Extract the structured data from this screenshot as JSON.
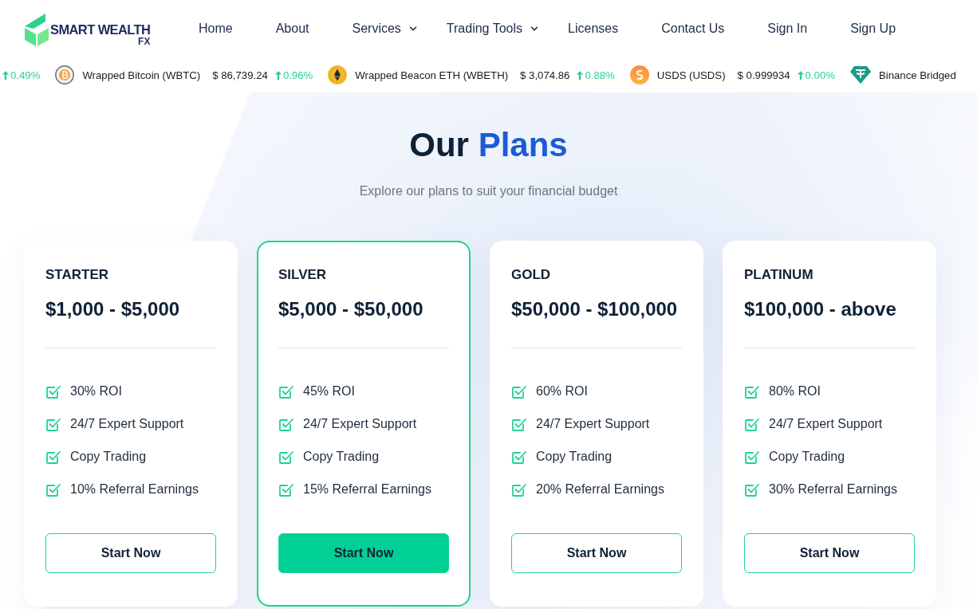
{
  "header": {
    "logo": {
      "name": "SMART WEALTH",
      "suffix": "FX"
    },
    "nav": [
      {
        "label": "Home",
        "dropdown": false
      },
      {
        "label": "About",
        "dropdown": false
      },
      {
        "label": "Services",
        "dropdown": true
      },
      {
        "label": "Trading Tools",
        "dropdown": true
      },
      {
        "label": "Licenses",
        "dropdown": false
      },
      {
        "label": "Contact Us",
        "dropdown": false
      },
      {
        "label": "Sign In",
        "dropdown": false
      },
      {
        "label": "Sign Up",
        "dropdown": false
      }
    ]
  },
  "ticker": [
    {
      "change": "0.49%",
      "up": true
    },
    {
      "kind": "b-coin",
      "name": "Wrapped Bitcoin (WBTC)",
      "price": "$ 86,739.24",
      "change": "0.96%",
      "up": true
    },
    {
      "kind": "eth-coin",
      "name": "Wrapped Beacon ETH (WBETH)",
      "price": "$ 3,074.86",
      "change": "0.88%",
      "up": true
    },
    {
      "kind": "s-coin",
      "name": "USDS (USDS)",
      "price": "$ 0.999934",
      "change": "0.00%",
      "up": true
    },
    {
      "kind": "t-diamond",
      "name": "Binance Bridged"
    }
  ],
  "section": {
    "title": "Our",
    "title_accent": "Plans",
    "subtitle": "Explore our plans to suit your financial budget"
  },
  "plans": [
    {
      "name": "STARTER",
      "price": "$1,000 - $5,000",
      "features": [
        "30% ROI",
        "24/7 Expert Support",
        "Copy Trading",
        "10% Referral Earnings"
      ],
      "button": "Start Now",
      "selected": false
    },
    {
      "name": "SILVER",
      "price": "$5,000 - $50,000",
      "features": [
        "45% ROI",
        "24/7 Expert Support",
        "Copy Trading",
        "15% Referral Earnings"
      ],
      "button": "Start Now",
      "selected": true
    },
    {
      "name": "GOLD",
      "price": "$50,000 - $100,000",
      "features": [
        "60% ROI",
        "24/7 Expert Support",
        "Copy Trading",
        "20% Referral Earnings"
      ],
      "button": "Start Now",
      "selected": false
    },
    {
      "name": "PLATINUM",
      "price": "$100,000 - above",
      "features": [
        "80% ROI",
        "24/7 Expert Support",
        "Copy Trading",
        "30% Referral Earnings"
      ],
      "button": "Start Now",
      "selected": false
    }
  ]
}
